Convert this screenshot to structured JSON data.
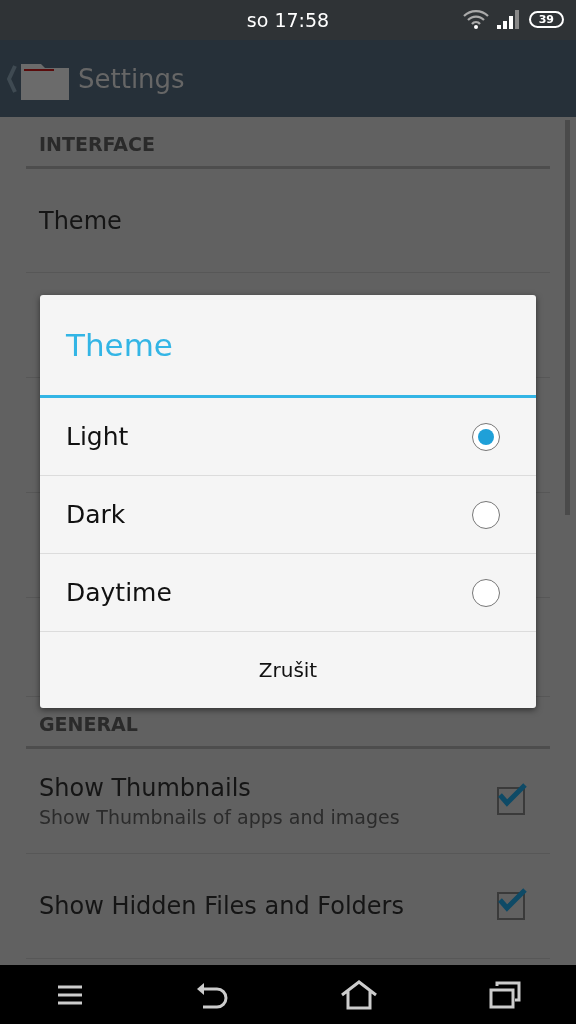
{
  "status_bar": {
    "time": "so 17:58",
    "battery": "39"
  },
  "action_bar": {
    "title": "Settings"
  },
  "sections": [
    {
      "header": "INTERFACE",
      "rows": [
        {
          "kind": "plain",
          "title": "Theme"
        },
        {
          "kind": "hidden"
        },
        {
          "kind": "hidden"
        },
        {
          "kind": "hidden"
        },
        {
          "kind": "hidden"
        }
      ]
    },
    {
      "header": "GENERAL",
      "rows": [
        {
          "kind": "check",
          "title": "Show Thumbnails",
          "summary": "Show Thumbnails of apps and images",
          "checked": true
        },
        {
          "kind": "check",
          "title": "Show Hidden Files and Folders",
          "checked": true
        }
      ]
    }
  ],
  "dialog": {
    "title": "Theme",
    "options": [
      {
        "label": "Light",
        "selected": true
      },
      {
        "label": "Dark",
        "selected": false
      },
      {
        "label": "Daytime",
        "selected": false
      }
    ],
    "button": "Zrušit"
  }
}
